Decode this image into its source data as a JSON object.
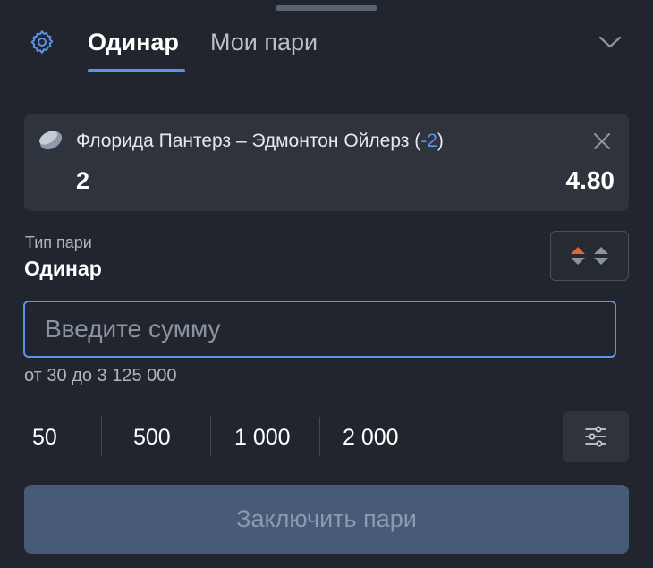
{
  "header": {
    "tab_single": "Одинар",
    "tab_my_bets": "Мои пари",
    "settings_icon": "gear-icon",
    "collapse_icon": "chevron-down-icon"
  },
  "bet_card": {
    "event": "Флорида Пантерз – Эдмонтон Ойлерз (",
    "handicap": "-2",
    "event_close": ")",
    "outcome": "2",
    "odds": "4.80",
    "sport_icon": "hockey-puck-icon",
    "remove_icon": "close-icon"
  },
  "bet_type": {
    "label": "Тип пари",
    "value": "Одинар",
    "sort_icon": "sort-arrows-icon"
  },
  "amount": {
    "placeholder": "Введите сумму",
    "value": "",
    "range_hint": "от 30 до 3 125 000"
  },
  "quick_amounts": [
    "50",
    "500",
    "1 000",
    "2 000"
  ],
  "presets_icon": "sliders-icon",
  "submit_label": "Заключить пари",
  "colors": {
    "accent": "#5d93e8",
    "background": "#21252d",
    "card": "#2e333c",
    "submit_disabled": "#475b78",
    "sort_up": "#e0653a"
  }
}
